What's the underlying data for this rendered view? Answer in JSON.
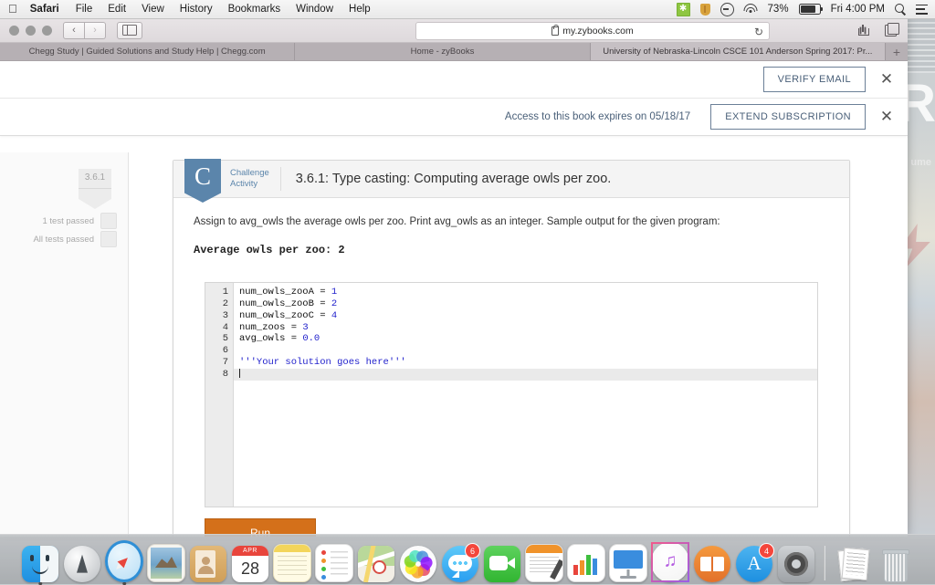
{
  "menubar": {
    "apple": "apple-logo",
    "items": [
      "Safari",
      "File",
      "Edit",
      "View",
      "History",
      "Bookmarks",
      "Window",
      "Help"
    ],
    "status": {
      "battery_percent": "73%",
      "clock": "Fri 4:00 PM"
    }
  },
  "browser": {
    "url": "my.zybooks.com",
    "reload_glyph": "↻",
    "back_glyph": "‹",
    "forward_glyph": "›",
    "tabs": [
      {
        "title": "Chegg Study | Guided Solutions and Study Help | Chegg.com",
        "active": false
      },
      {
        "title": "Home - zyBooks",
        "active": false
      },
      {
        "title": "University of Nebraska-Lincoln CSCE 101 Anderson Spring 2017: Pr...",
        "active": true
      }
    ],
    "new_tab_glyph": "+"
  },
  "banners": [
    {
      "text": "",
      "button": "VERIFY EMAIL",
      "close": "✕"
    },
    {
      "text": "Access to this book expires on 05/18/17",
      "button": "EXTEND SUBSCRIPTION",
      "close": "✕"
    }
  ],
  "sidebar": {
    "badge_number": "3.6.1",
    "tests": [
      {
        "label": "1 test passed",
        "checked": false
      },
      {
        "label": "All tests passed",
        "checked": false
      }
    ]
  },
  "activity": {
    "badge_letter": "C",
    "type_line1": "Challenge",
    "type_line2": "Activity",
    "title": "3.6.1: Type casting: Computing average owls per zoo.",
    "instructions": "Assign to avg_owls the average owls per zoo. Print avg_owls as an integer. Sample output for the given program:",
    "sample_output": "Average owls per zoo: 2",
    "run_label": "Run",
    "accent_color": "#5b85ab",
    "run_color": "#d4701a"
  },
  "editor": {
    "line_numbers": [
      "1",
      "2",
      "3",
      "4",
      "5",
      "6",
      "7",
      "8"
    ],
    "current_line": 8,
    "lines": [
      {
        "n": 1,
        "parts": [
          {
            "t": "num_owls_zooA = ",
            "c": "plain"
          },
          {
            "t": "1",
            "c": "num"
          }
        ]
      },
      {
        "n": 2,
        "parts": [
          {
            "t": "num_owls_zooB = ",
            "c": "plain"
          },
          {
            "t": "2",
            "c": "num"
          }
        ]
      },
      {
        "n": 3,
        "parts": [
          {
            "t": "num_owls_zooC = ",
            "c": "plain"
          },
          {
            "t": "4",
            "c": "num"
          }
        ]
      },
      {
        "n": 4,
        "parts": [
          {
            "t": "num_zoos = ",
            "c": "plain"
          },
          {
            "t": "3",
            "c": "num"
          }
        ]
      },
      {
        "n": 5,
        "parts": [
          {
            "t": "avg_owls = ",
            "c": "plain"
          },
          {
            "t": "0.0",
            "c": "num"
          }
        ]
      },
      {
        "n": 6,
        "parts": []
      },
      {
        "n": 7,
        "parts": [
          {
            "t": "'''Your solution goes here'''",
            "c": "str"
          }
        ]
      },
      {
        "n": 8,
        "parts": []
      }
    ]
  },
  "dock": {
    "items": [
      {
        "name": "finder",
        "label": "Finder",
        "running": true
      },
      {
        "name": "launchpad",
        "label": "Launchpad",
        "running": false
      },
      {
        "name": "safari",
        "label": "Safari",
        "running": true
      },
      {
        "name": "mail",
        "label": "Mail",
        "running": false
      },
      {
        "name": "contacts",
        "label": "Contacts",
        "running": false
      },
      {
        "name": "calendar",
        "label": "Calendar",
        "running": false,
        "month": "APR",
        "day": "28"
      },
      {
        "name": "notes",
        "label": "Notes",
        "running": false
      },
      {
        "name": "reminders",
        "label": "Reminders",
        "running": false
      },
      {
        "name": "maps",
        "label": "Maps",
        "running": false
      },
      {
        "name": "photos",
        "label": "Photos",
        "running": false
      },
      {
        "name": "messages",
        "label": "Messages",
        "running": false,
        "badge": "6"
      },
      {
        "name": "facetime",
        "label": "FaceTime",
        "running": false
      },
      {
        "name": "pages",
        "label": "Pages",
        "running": false
      },
      {
        "name": "numbers",
        "label": "Numbers",
        "running": false
      },
      {
        "name": "keynote",
        "label": "Keynote",
        "running": false
      },
      {
        "name": "itunes",
        "label": "iTunes",
        "running": false
      },
      {
        "name": "ibooks",
        "label": "iBooks",
        "running": false
      },
      {
        "name": "app-store",
        "label": "App Store",
        "running": false,
        "badge": "4"
      },
      {
        "name": "system-preferences",
        "label": "System Preferences",
        "running": false
      },
      {
        "name": "documents-stack",
        "label": "Documents",
        "running": false
      },
      {
        "name": "trash",
        "label": "Trash",
        "running": false
      }
    ]
  },
  "wallpaper": {
    "letter": "R",
    "word": "ume"
  }
}
